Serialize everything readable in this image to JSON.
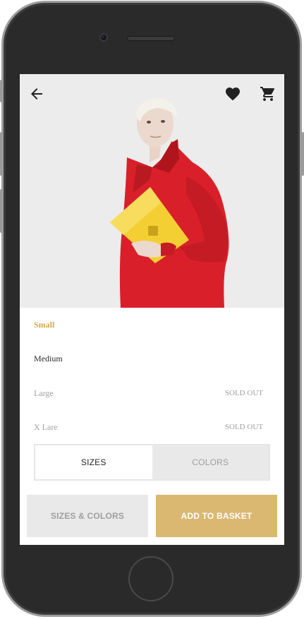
{
  "product": {
    "sizes": [
      {
        "label": "Small",
        "status": "",
        "state": "selected"
      },
      {
        "label": "Medium",
        "status": "",
        "state": "available"
      },
      {
        "label": "Large",
        "status": "SOLD OUT",
        "state": "sold_out"
      },
      {
        "label": "X Lare",
        "status": "SOLD OUT",
        "state": "sold_out"
      }
    ],
    "tabs": [
      {
        "label": "SIZES",
        "active": true
      },
      {
        "label": "COLORS",
        "active": false
      }
    ],
    "actions": {
      "sizes_colors_label": "SIZES & COLORS",
      "add_to_basket_label": "ADD TO BASKET"
    }
  },
  "topbar": {
    "icons": [
      "back-arrow-icon",
      "heart-icon",
      "cart-icon"
    ]
  },
  "colors": {
    "accent": "#dbb871",
    "selected_size": "#d3a650",
    "text_dark": "#2b2b2b",
    "text_muted": "#9e9e9e",
    "hero_bg": "#ececec",
    "coat": "#d9202a",
    "bag": "#f3cf33"
  }
}
